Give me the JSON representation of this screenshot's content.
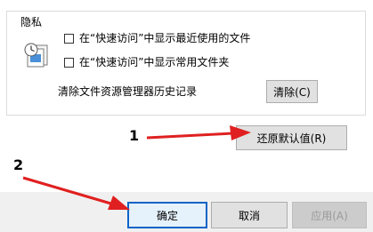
{
  "privacy": {
    "title": "隐私",
    "icon": "privacy-files-icon",
    "options": [
      {
        "label": "在“快速访问”中显示最近使用的文件",
        "checked": false
      },
      {
        "label": "在“快速访问”中显示常用文件夹",
        "checked": false
      }
    ],
    "clear_history_label": "清除文件资源管理器历史记录",
    "clear_button": "清除(C)"
  },
  "restore_button": "还原默认值(R)",
  "annotations": {
    "one": "1",
    "two": "2",
    "arrow_color": "#e02020"
  },
  "footer": {
    "ok": "确定",
    "cancel": "取消",
    "apply": "应用(A)"
  }
}
